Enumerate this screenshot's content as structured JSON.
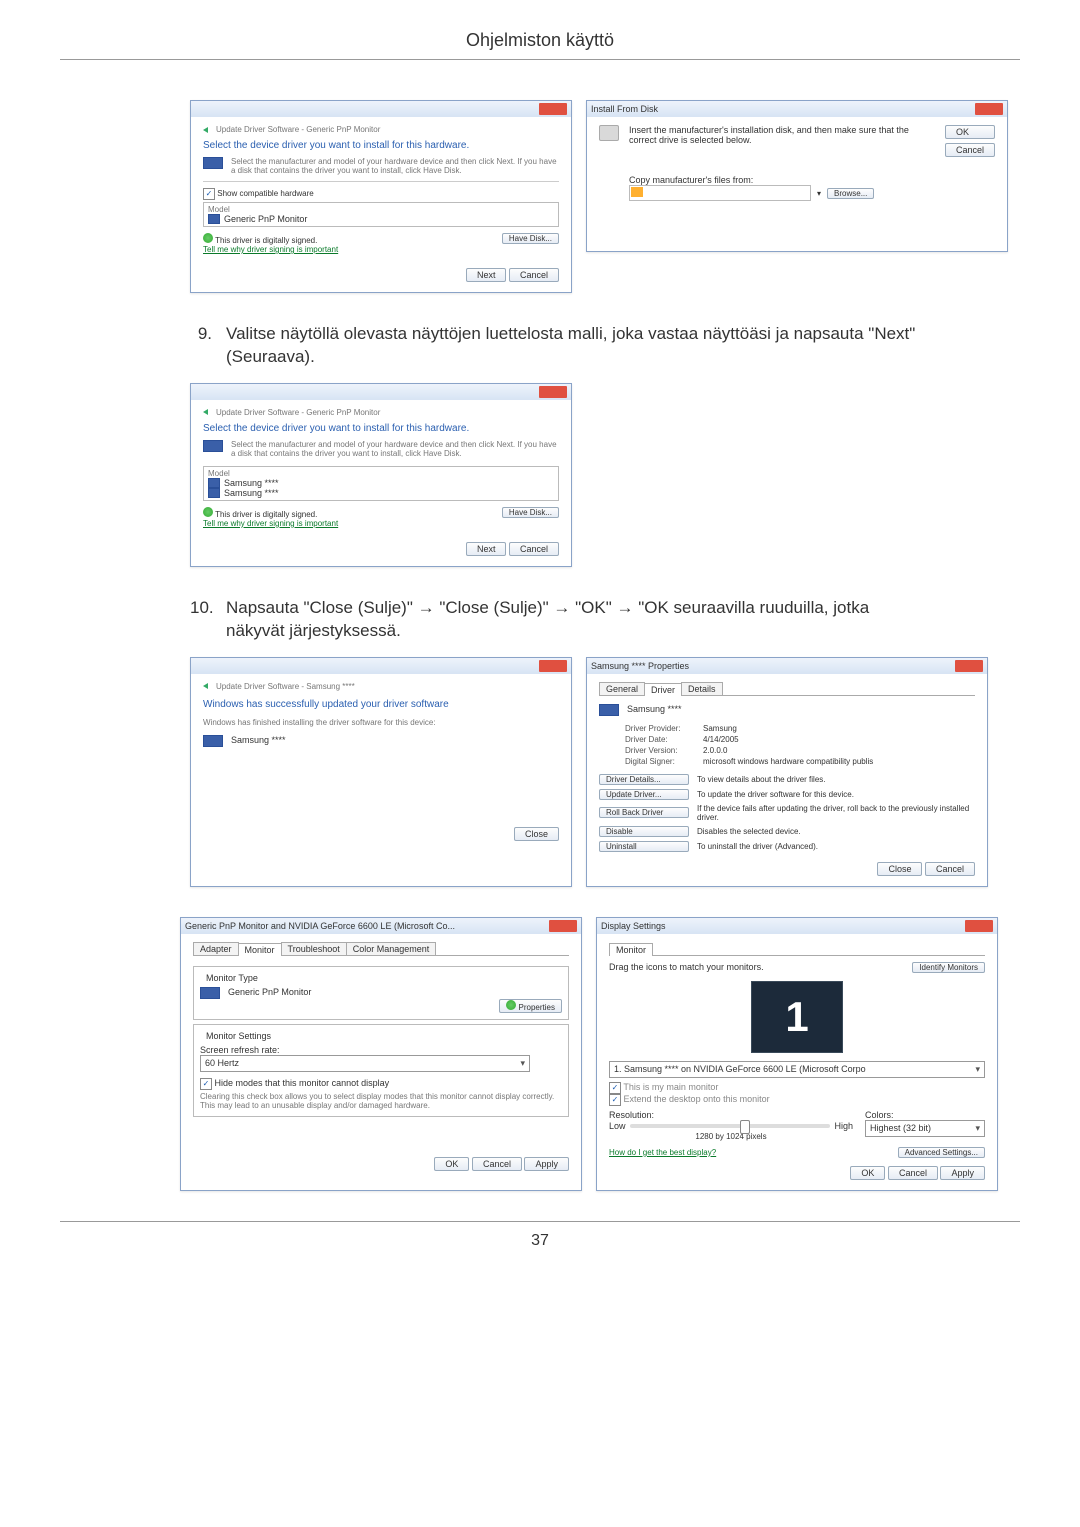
{
  "page": {
    "header": "Ohjelmiston käyttö",
    "number": "37"
  },
  "step9": {
    "num": "9.",
    "text": "Valitse näytöllä olevasta näyttöjen luettelosta malli, joka vastaa näyttöäsi ja napsauta \"Next\" (Seuraava)."
  },
  "step10": {
    "num": "10.",
    "text": "Napsauta \"Close (Sulje)\" → \"Close (Sulje)\" → \"OK\" → \"OK seuraavilla ruuduilla, jotka näkyvät järjestyksessä."
  },
  "dlg_update1": {
    "breadcrumb": "Update Driver Software - Generic PnP Monitor",
    "heading": "Select the device driver you want to install for this hardware.",
    "sub": "Select the manufacturer and model of your hardware device and then click Next. If you have a disk that contains the driver you want to install, click Have Disk.",
    "show_compat": "Show compatible hardware",
    "model_label": "Model",
    "model_item": "Generic PnP Monitor",
    "signed": "This driver is digitally signed.",
    "tell_me": "Tell me why driver signing is important",
    "have_disk": "Have Disk...",
    "next": "Next",
    "cancel": "Cancel"
  },
  "dlg_install": {
    "title": "Install From Disk",
    "text": "Insert the manufacturer's installation disk, and then make sure that the correct drive is selected below.",
    "ok": "OK",
    "cancel": "Cancel",
    "copy_label": "Copy manufacturer's files from:",
    "browse": "Browse..."
  },
  "dlg_update2": {
    "breadcrumb": "Update Driver Software - Generic PnP Monitor",
    "heading": "Select the device driver you want to install for this hardware.",
    "sub": "Select the manufacturer and model of your hardware device and then click Next. If you have a disk that contains the driver you want to install, click Have Disk.",
    "model_label": "Model",
    "model_item1": "Samsung ****",
    "model_item2": "Samsung ****",
    "signed": "This driver is digitally signed.",
    "tell_me": "Tell me why driver signing is important",
    "have_disk": "Have Disk...",
    "next": "Next",
    "cancel": "Cancel"
  },
  "dlg_update3": {
    "breadcrumb": "Update Driver Software - Samsung ****",
    "heading": "Windows has successfully updated your driver software",
    "sub": "Windows has finished installing the driver software for this device:",
    "device": "Samsung ****",
    "close": "Close"
  },
  "dlg_props": {
    "title": "Samsung **** Properties",
    "tab_general": "General",
    "tab_driver": "Driver",
    "tab_details": "Details",
    "device": "Samsung ****",
    "rows": {
      "provider_lab": "Driver Provider:",
      "provider_val": "Samsung",
      "date_lab": "Driver Date:",
      "date_val": "4/14/2005",
      "version_lab": "Driver Version:",
      "version_val": "2.0.0.0",
      "signer_lab": "Digital Signer:",
      "signer_val": "microsoft windows hardware compatibility publis"
    },
    "btn_details": "Driver Details...",
    "btn_details_txt": "To view details about the driver files.",
    "btn_update": "Update Driver...",
    "btn_update_txt": "To update the driver software for this device.",
    "btn_rollback": "Roll Back Driver",
    "btn_rollback_txt": "If the device fails after updating the driver, roll back to the previously installed driver.",
    "btn_disable": "Disable",
    "btn_disable_txt": "Disables the selected device.",
    "btn_uninstall": "Uninstall",
    "btn_uninstall_txt": "To uninstall the driver (Advanced).",
    "close": "Close",
    "cancel": "Cancel"
  },
  "dlg_adapter": {
    "title": "Generic PnP Monitor and NVIDIA GeForce 6600 LE (Microsoft Co...",
    "tab_adapter": "Adapter",
    "tab_monitor": "Monitor",
    "tab_trouble": "Troubleshoot",
    "tab_color": "Color Management",
    "monitor_type_label": "Monitor Type",
    "monitor_type": "Generic PnP Monitor",
    "properties_btn": "Properties",
    "monitor_settings_label": "Monitor Settings",
    "refresh_label": "Screen refresh rate:",
    "refresh_val": "60 Hertz",
    "hide_modes": "Hide modes that this monitor cannot display",
    "hide_modes_desc": "Clearing this check box allows you to select display modes that this monitor cannot display correctly. This may lead to an unusable display and/or damaged hardware.",
    "ok": "OK",
    "cancel": "Cancel",
    "apply": "Apply"
  },
  "dlg_display": {
    "title": "Display Settings",
    "tab_monitor": "Monitor",
    "drag_text": "Drag the icons to match your monitors.",
    "identify": "Identify Monitors",
    "monitor_num": "1",
    "monitor_select": "1. Samsung **** on NVIDIA GeForce 6600 LE (Microsoft Corpo",
    "main_monitor": "This is my main monitor",
    "extend": "Extend the desktop onto this monitor",
    "resolution_label": "Resolution:",
    "low": "Low",
    "high": "High",
    "res_val": "1280 by 1024 pixels",
    "colors_label": "Colors:",
    "colors_val": "Highest (32 bit)",
    "best_display": "How do I get the best display?",
    "adv": "Advanced Settings...",
    "ok": "OK",
    "cancel": "Cancel",
    "apply": "Apply"
  }
}
